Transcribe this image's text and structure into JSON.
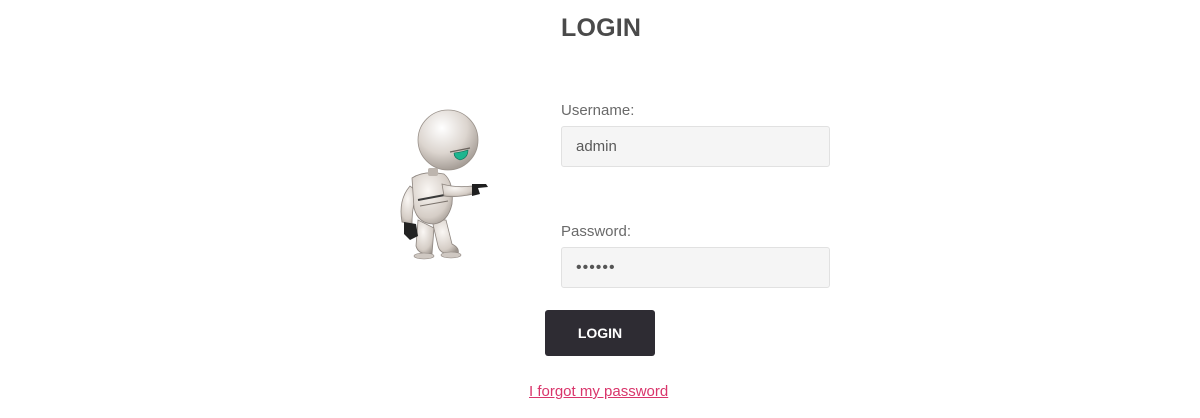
{
  "form": {
    "title": "LOGIN",
    "username_label": "Username:",
    "username_value": "admin",
    "password_label": "Password:",
    "password_value": "123456",
    "submit_label": "LOGIN",
    "forgot_link": "I forgot my password"
  },
  "illustration": {
    "name": "robot-mascot"
  },
  "colors": {
    "button_bg": "#2e2c33",
    "link": "#d9356b",
    "input_bg": "#f5f5f5",
    "title": "#4a4a4a"
  }
}
